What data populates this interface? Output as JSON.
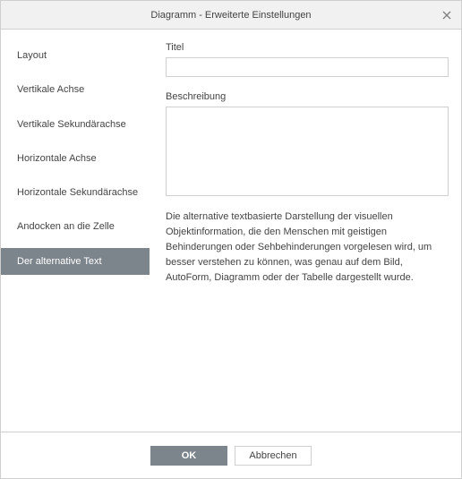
{
  "dialog": {
    "title": "Diagramm - Erweiterte Einstellungen"
  },
  "sidebar": {
    "items": [
      {
        "label": "Layout",
        "active": false
      },
      {
        "label": "Vertikale Achse",
        "active": false
      },
      {
        "label": "Vertikale Sekundärachse",
        "active": false
      },
      {
        "label": "Horizontale Achse",
        "active": false
      },
      {
        "label": "Horizontale Sekundärachse",
        "active": false
      },
      {
        "label": "Andocken an die Zelle",
        "active": false
      },
      {
        "label": "Der alternative Text",
        "active": true
      }
    ]
  },
  "content": {
    "title_label": "Titel",
    "title_value": "",
    "description_label": "Beschreibung",
    "description_value": "",
    "help_text": "Die alternative textbasierte Darstellung der visuellen Objektinformation, die den Menschen mit geistigen Behinderungen oder Sehbehinderungen vorgelesen wird, um besser verstehen zu können, was genau auf dem Bild, AutoForm, Diagramm oder der Tabelle dargestellt wurde."
  },
  "footer": {
    "ok_label": "OK",
    "cancel_label": "Abbrechen"
  }
}
